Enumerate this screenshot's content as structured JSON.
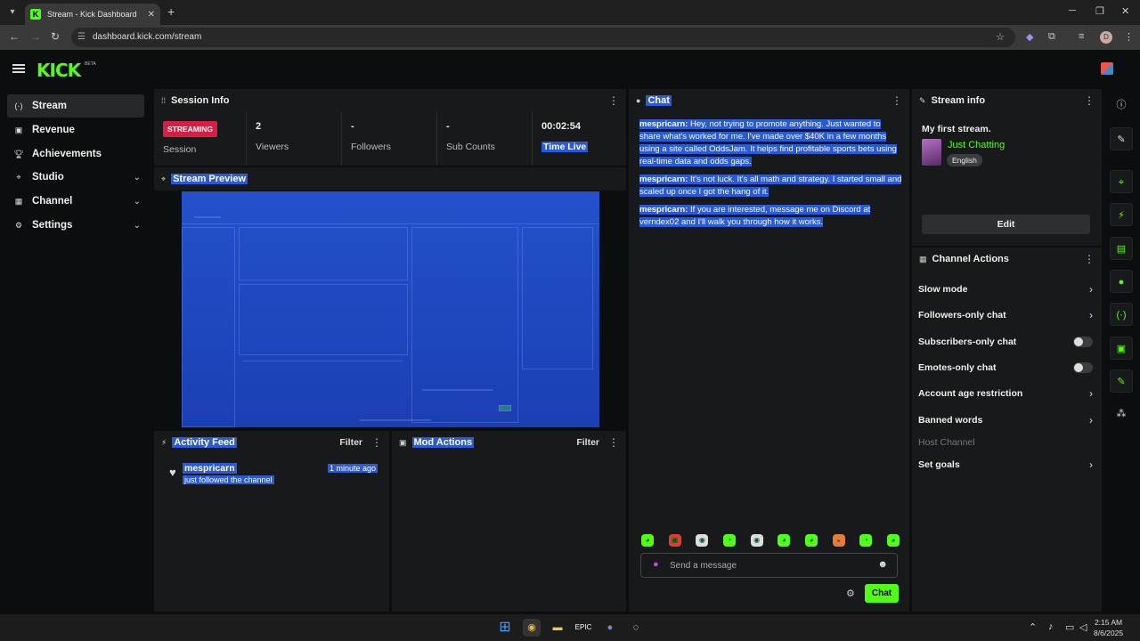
{
  "browser": {
    "tab_title": "Stream - Kick Dashboard",
    "tab_favicon": "K",
    "url": "dashboard.kick.com/stream",
    "profile_initial": "D"
  },
  "brand": {
    "logo": "KICK",
    "beta": "BETA",
    "accent": "#53fc18"
  },
  "sidebar": {
    "items": [
      {
        "label": "Stream",
        "icon": "broadcast-icon"
      },
      {
        "label": "Revenue",
        "icon": "revenue-icon"
      },
      {
        "label": "Achievements",
        "icon": "trophy-icon"
      },
      {
        "label": "Studio",
        "icon": "studio-icon"
      },
      {
        "label": "Channel",
        "icon": "channel-icon"
      },
      {
        "label": "Settings",
        "icon": "gear-icon"
      }
    ]
  },
  "session": {
    "title": "Session Info",
    "status_badge": "STREAMING",
    "session_label": "Session",
    "viewers_value": "2",
    "viewers_label": "Viewers",
    "followers_value": "-",
    "followers_label": "Followers",
    "subs_value": "-",
    "subs_label": "Sub Counts",
    "time_value": "00:02:54",
    "time_label": "Time Live"
  },
  "preview": {
    "title": "Stream Preview"
  },
  "activity": {
    "title": "Activity Feed",
    "filter": "Filter",
    "user": "mespricarn",
    "action": "just followed the channel",
    "time": "1 minute ago"
  },
  "mod": {
    "title": "Mod Actions",
    "filter": "Filter"
  },
  "chat": {
    "title": "Chat",
    "messages": [
      {
        "user": "mespricarn:",
        "text": " Hey, not trying to promote anything. Just wanted to share what's worked for me. I've made over $40K in a few months using a site called OddsJam. It helps find profitable sports bets using real-time data and odds gaps."
      },
      {
        "user": "mespricarn:",
        "text": " It's not luck. It's all math and strategy. I started small and scaled up once I got the hang of it."
      },
      {
        "user": "mespricarn:",
        "text": " If you are interested, message me on Discord at verndex02 and I'll walk you through how it works."
      }
    ],
    "placeholder": "Send a message",
    "send_label": "Chat"
  },
  "stream_info": {
    "title": "Stream info",
    "stream_title": "My first stream.",
    "category": "Just Chatting",
    "language": "English",
    "edit_label": "Edit"
  },
  "channel_actions": {
    "title": "Channel Actions",
    "items": [
      {
        "label": "Slow mode",
        "control": "chevron"
      },
      {
        "label": "Followers-only chat",
        "control": "chevron"
      },
      {
        "label": "Subscribers-only chat",
        "control": "toggle"
      },
      {
        "label": "Emotes-only chat",
        "control": "toggle"
      },
      {
        "label": "Account age restriction",
        "control": "chevron"
      },
      {
        "label": "Banned words",
        "control": "chevron"
      },
      {
        "label": "Host Channel",
        "control": "none"
      },
      {
        "label": "Set goals",
        "control": "chevron"
      }
    ]
  },
  "taskbar": {
    "time": "2:15 AM",
    "date": "8/6/2025"
  }
}
